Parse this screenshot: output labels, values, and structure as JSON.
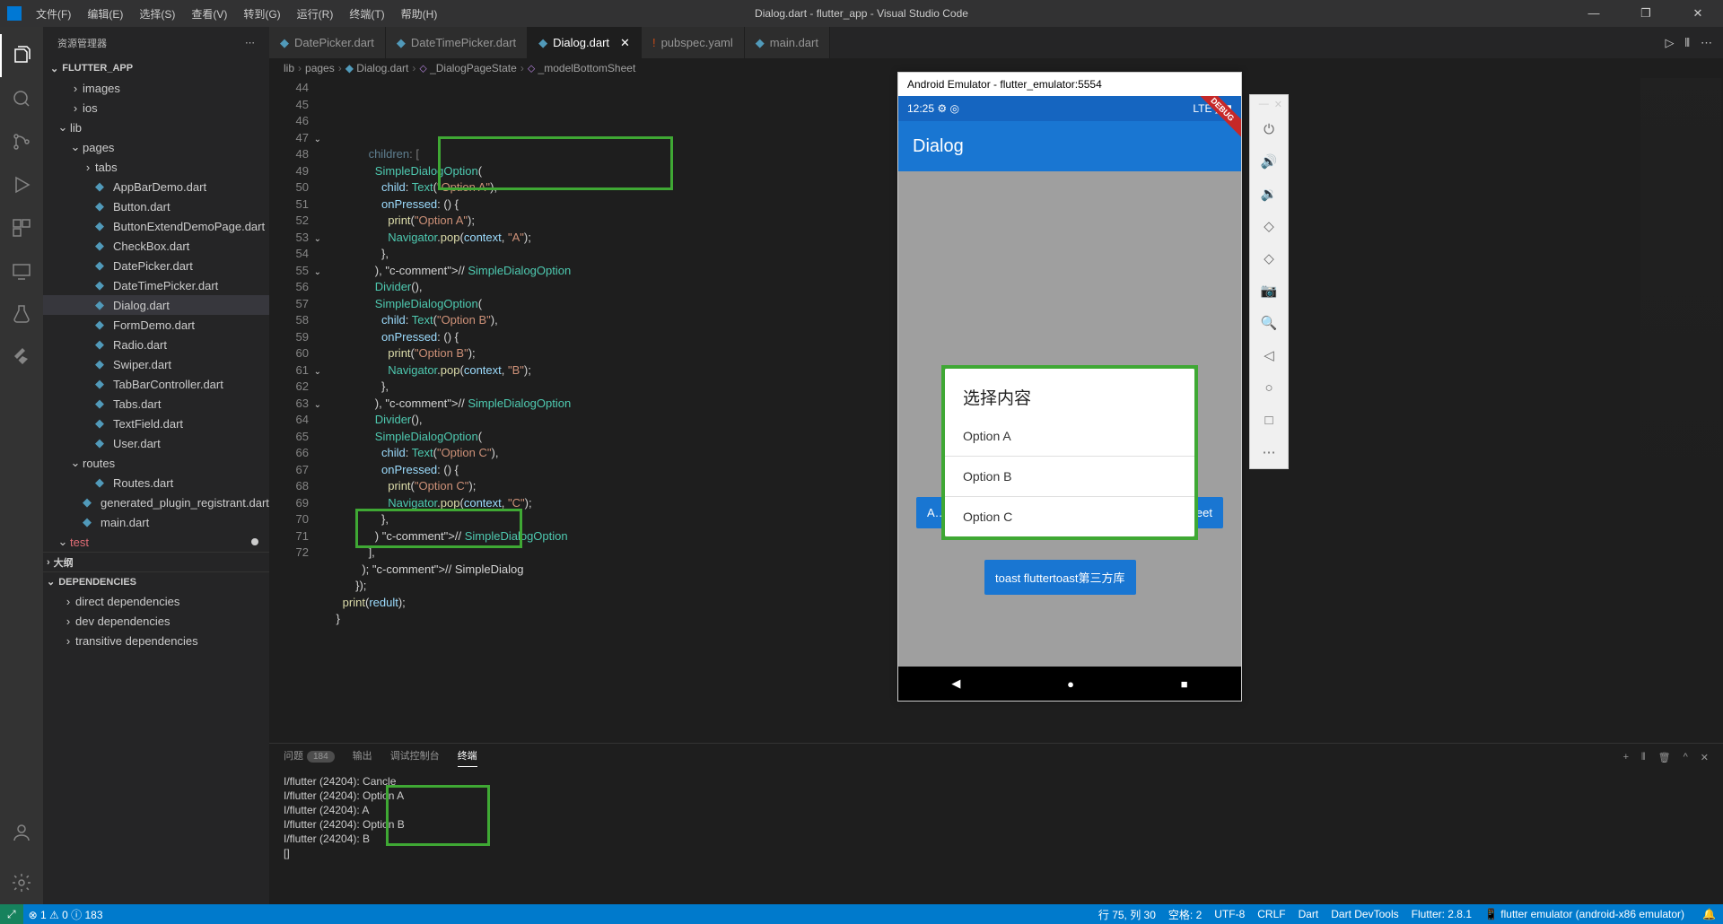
{
  "titlebar": {
    "menus": [
      "文件(F)",
      "编辑(E)",
      "选择(S)",
      "查看(V)",
      "转到(G)",
      "运行(R)",
      "终端(T)",
      "帮助(H)"
    ],
    "title": "Dialog.dart - flutter_app - Visual Studio Code"
  },
  "sidebar": {
    "header": "资源管理器",
    "project": "FLUTTER_APP",
    "tree": [
      {
        "label": "images",
        "indent": 28,
        "chev": "›",
        "icon": ""
      },
      {
        "label": "ios",
        "indent": 28,
        "chev": "›",
        "icon": ""
      },
      {
        "label": "lib",
        "indent": 14,
        "chev": "⌄",
        "icon": ""
      },
      {
        "label": "pages",
        "indent": 28,
        "chev": "⌄",
        "icon": ""
      },
      {
        "label": "tabs",
        "indent": 42,
        "chev": "›",
        "icon": ""
      },
      {
        "label": "AppBarDemo.dart",
        "indent": 42,
        "icon": "◆"
      },
      {
        "label": "Button.dart",
        "indent": 42,
        "icon": "◆"
      },
      {
        "label": "ButtonExtendDemoPage.dart",
        "indent": 42,
        "icon": "◆"
      },
      {
        "label": "CheckBox.dart",
        "indent": 42,
        "icon": "◆"
      },
      {
        "label": "DatePicker.dart",
        "indent": 42,
        "icon": "◆"
      },
      {
        "label": "DateTimePicker.dart",
        "indent": 42,
        "icon": "◆"
      },
      {
        "label": "Dialog.dart",
        "indent": 42,
        "icon": "◆",
        "active": true
      },
      {
        "label": "FormDemo.dart",
        "indent": 42,
        "icon": "◆"
      },
      {
        "label": "Radio.dart",
        "indent": 42,
        "icon": "◆"
      },
      {
        "label": "Swiper.dart",
        "indent": 42,
        "icon": "◆"
      },
      {
        "label": "TabBarController.dart",
        "indent": 42,
        "icon": "◆"
      },
      {
        "label": "Tabs.dart",
        "indent": 42,
        "icon": "◆"
      },
      {
        "label": "TextField.dart",
        "indent": 42,
        "icon": "◆"
      },
      {
        "label": "User.dart",
        "indent": 42,
        "icon": "◆"
      },
      {
        "label": "routes",
        "indent": 28,
        "chev": "⌄",
        "icon": ""
      },
      {
        "label": "Routes.dart",
        "indent": 42,
        "icon": "◆"
      },
      {
        "label": "generated_plugin_registrant.dart",
        "indent": 28,
        "icon": "◆"
      },
      {
        "label": "main.dart",
        "indent": 28,
        "icon": "◆"
      },
      {
        "label": "test",
        "indent": 14,
        "chev": "⌄",
        "icon": "",
        "cls": "test-red",
        "unsaved": true
      }
    ],
    "outline": "大纲",
    "dependencies": "DEPENDENCIES",
    "deps": [
      "direct dependencies",
      "dev dependencies",
      "transitive dependencies"
    ]
  },
  "tabs": {
    "items": [
      {
        "label": "DatePicker.dart"
      },
      {
        "label": "DateTimePicker.dart"
      },
      {
        "label": "Dialog.dart",
        "active": true,
        "close": true
      },
      {
        "label": "pubspec.yaml",
        "yaml": true
      },
      {
        "label": "main.dart"
      }
    ]
  },
  "breadcrumb": {
    "parts": [
      "lib",
      "pages",
      "Dialog.dart",
      "_DialogPageState",
      "_modelBottomSheet"
    ]
  },
  "code": {
    "start": 44,
    "lines": [
      {
        "n": 44,
        "t": "              children: [",
        "fade": true
      },
      {
        "n": 45,
        "t": "                SimpleDialogOption("
      },
      {
        "n": 46,
        "t": "                  child: Text(\"Option A\"),"
      },
      {
        "n": 47,
        "fold": "⌄",
        "t": "                  onPressed: () {"
      },
      {
        "n": 48,
        "t": "                    print(\"Option A\");"
      },
      {
        "n": 49,
        "t": "                    Navigator.pop(context, \"A\");"
      },
      {
        "n": 50,
        "t": "                  },"
      },
      {
        "n": 51,
        "t": "                ), // SimpleDialogOption"
      },
      {
        "n": 52,
        "t": "                Divider(),"
      },
      {
        "n": 53,
        "fold": "⌄",
        "t": "                SimpleDialogOption("
      },
      {
        "n": 54,
        "t": "                  child: Text(\"Option B\"),"
      },
      {
        "n": 55,
        "fold": "⌄",
        "t": "                  onPressed: () {"
      },
      {
        "n": 56,
        "t": "                    print(\"Option B\");"
      },
      {
        "n": 57,
        "t": "                    Navigator.pop(context, \"B\");"
      },
      {
        "n": 58,
        "t": "                  },"
      },
      {
        "n": 59,
        "t": "                ), // SimpleDialogOption"
      },
      {
        "n": 60,
        "t": "                Divider(),"
      },
      {
        "n": 61,
        "fold": "⌄",
        "t": "                SimpleDialogOption("
      },
      {
        "n": 62,
        "t": "                  child: Text(\"Option C\"),"
      },
      {
        "n": 63,
        "fold": "⌄",
        "t": "                  onPressed: () {"
      },
      {
        "n": 64,
        "t": "                    print(\"Option C\");"
      },
      {
        "n": 65,
        "t": "                    Navigator.pop(context, \"C\");"
      },
      {
        "n": 66,
        "t": "                  },"
      },
      {
        "n": 67,
        "t": "                ) // SimpleDialogOption"
      },
      {
        "n": 68,
        "t": "              ],"
      },
      {
        "n": 69,
        "t": "            ); // SimpleDialog"
      },
      {
        "n": 70,
        "t": "          });"
      },
      {
        "n": 71,
        "t": "      print(redult);"
      },
      {
        "n": 72,
        "t": "    }"
      }
    ]
  },
  "panel": {
    "tabs": {
      "problems": "问题",
      "problems_count": "184",
      "output": "输出",
      "debug": "调试控制台",
      "terminal": "终端"
    },
    "out": [
      "I/flutter (24204): Cancle",
      "I/flutter (24204): Option A",
      "I/flutter (24204): A",
      "I/flutter (24204): Option B",
      "I/flutter (24204): B",
      "[]"
    ]
  },
  "emulator": {
    "title": "Android Emulator - flutter_emulator:5554",
    "time": "12:25",
    "status_right": "LTE ◢ ▮",
    "appbar": "Dialog",
    "debug": "DEBUG",
    "dialog": {
      "title": "选择内容",
      "options": [
        "Option A",
        "Option B",
        "Option C"
      ]
    },
    "btn1": "A…",
    "btn2": "…eet",
    "btn3": "toast fluttertoast第三方库"
  },
  "statusbar": {
    "errors": "1",
    "warnings": "0",
    "info": "183",
    "pos": "行 75, 列 30",
    "spaces": "空格: 2",
    "enc": "UTF-8",
    "eol": "CRLF",
    "lang": "Dart",
    "devtools": "Dart DevTools",
    "flutter": "Flutter: 2.8.1",
    "device": "flutter emulator (android-x86 emulator)"
  }
}
